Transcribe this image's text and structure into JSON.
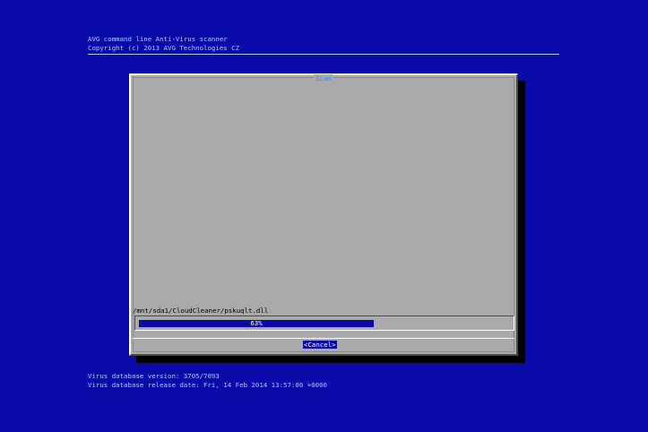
{
  "header": {
    "line1": "AVG command line Anti-Virus scanner",
    "line2": "Copyright (c) 2013 AVG Technologies CZ"
  },
  "dialog": {
    "title": "Scan",
    "current_file": "/mnt/sda1/CloudCleaner/pskuqlt.dll",
    "progress": {
      "fraction": 0.63,
      "label": "63%"
    },
    "cancel_label": "<Cancel>"
  },
  "footer": {
    "db_version": "Virus database version: 3705/7093",
    "db_release": "Virus database release date: Fri, 14 Feb 2014 13:57:00 +0000"
  },
  "colors": {
    "background": "#0a0aa8",
    "header_text": "#9fd0f0",
    "dialog_body": "#aaaaaa",
    "progress_fill": "#0a0aa8",
    "title_text": "#2f8fcf"
  }
}
